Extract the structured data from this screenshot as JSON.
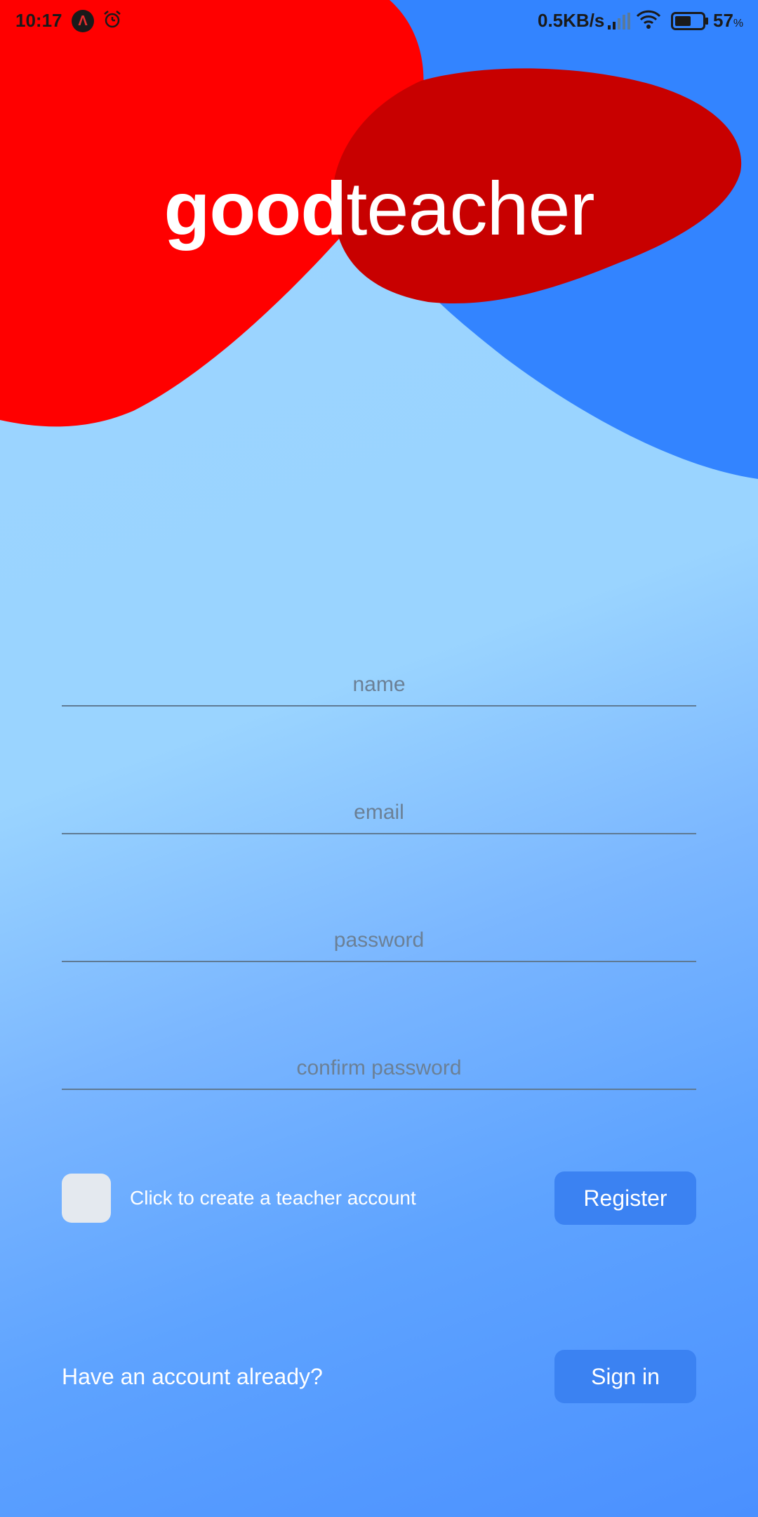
{
  "status_bar": {
    "time": "10:17",
    "net_speed": "0.5KB/s",
    "battery_value": "57",
    "battery_unit": "%",
    "icons": [
      "app-badge-icon",
      "alarm-icon",
      "signal-icon",
      "wifi-icon",
      "battery-icon"
    ]
  },
  "logo": {
    "bold_part": "good",
    "light_part": "teacher"
  },
  "form": {
    "name_placeholder": "name",
    "email_placeholder": "email",
    "password_placeholder": "password",
    "confirm_placeholder": "confirm password",
    "teacher_checkbox_label": "Click to create a teacher account",
    "register_label": "Register"
  },
  "footer": {
    "have_account_text": "Have an account already?",
    "signin_label": "Sign in"
  },
  "colors": {
    "background_light": "#9ad4ff",
    "background_dark": "#4a90ff",
    "blob_red": "#ff0000",
    "blob_dark_red": "#c80000",
    "blob_blue": "#3384ff",
    "button": "#3b82f2"
  }
}
